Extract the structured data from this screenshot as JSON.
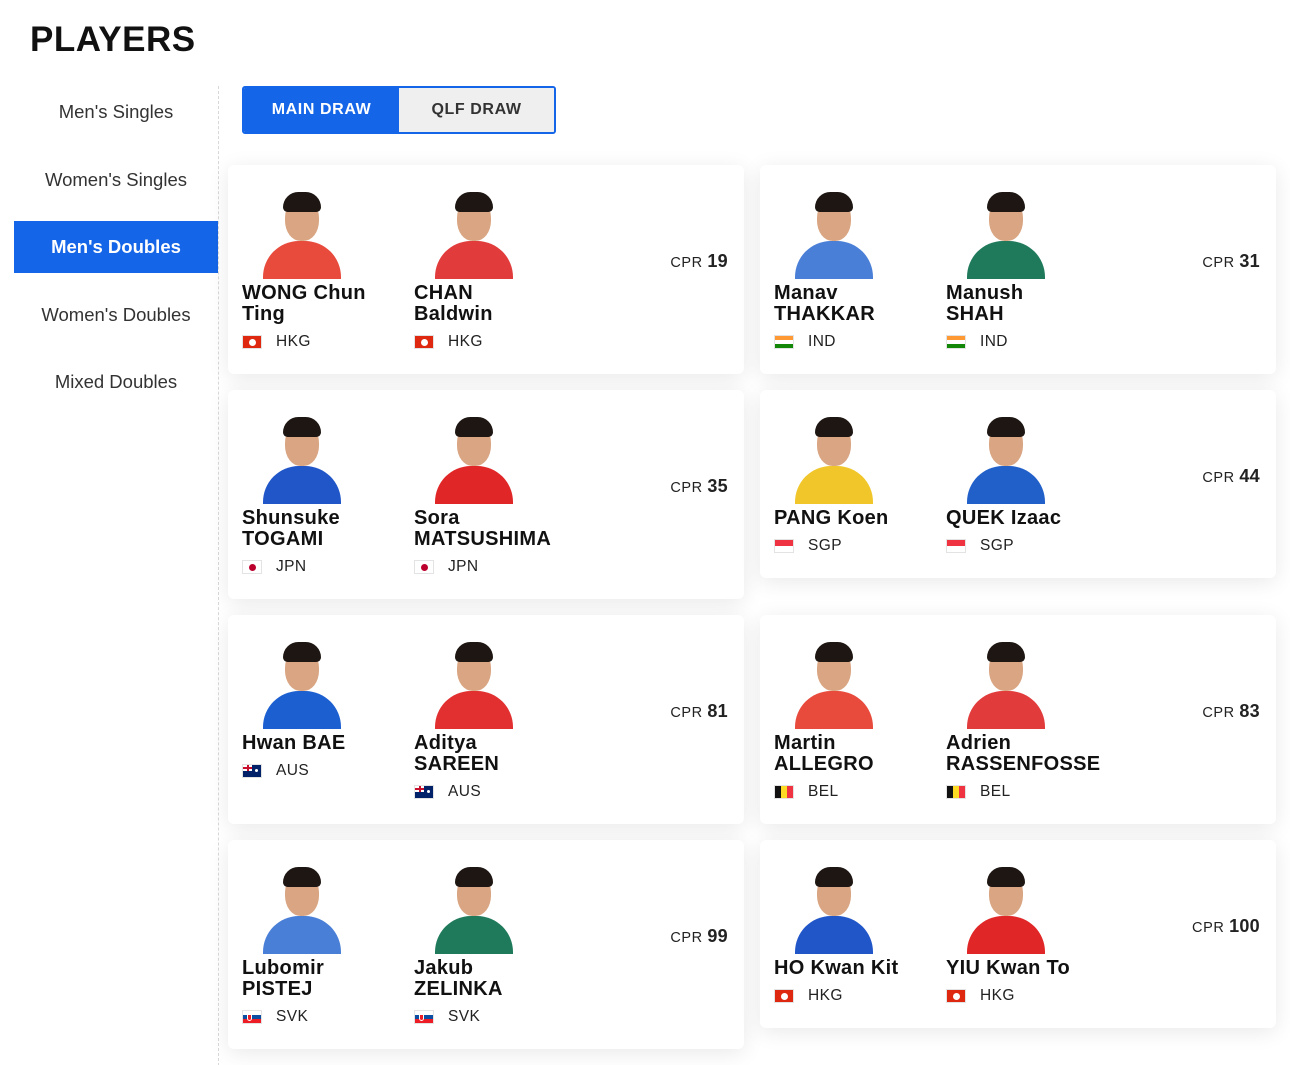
{
  "page": {
    "title": "PLAYERS"
  },
  "sidebar": {
    "items": [
      {
        "label": "Men's Singles",
        "active": false
      },
      {
        "label": "Women's Singles",
        "active": false
      },
      {
        "label": "Men's Doubles",
        "active": true
      },
      {
        "label": "Women's Doubles",
        "active": false
      },
      {
        "label": "Mixed Doubles",
        "active": false
      }
    ]
  },
  "draw_toggle": {
    "main_label": "MAIN DRAW",
    "qlf_label": "QLF DRAW",
    "selected": "MAIN DRAW"
  },
  "colors": {
    "accent": "#1565e8"
  },
  "cpr_label": "CPR",
  "pairs": [
    {
      "cpr": "19",
      "players": [
        {
          "name_line1": "WONG Chun",
          "name_line2": "Ting",
          "country": "HKG",
          "flag": "flag-hkg-icon"
        },
        {
          "name_line1": "CHAN",
          "name_line2": "Baldwin",
          "country": "HKG",
          "flag": "flag-hkg-icon"
        }
      ]
    },
    {
      "cpr": "31",
      "players": [
        {
          "name_line1": "Manav",
          "name_line2": "THAKKAR",
          "country": "IND",
          "flag": "flag-ind-icon"
        },
        {
          "name_line1": "Manush",
          "name_line2": "SHAH",
          "country": "IND",
          "flag": "flag-ind-icon"
        }
      ]
    },
    {
      "cpr": "35",
      "players": [
        {
          "name_line1": "Shunsuke",
          "name_line2": "TOGAMI",
          "country": "JPN",
          "flag": "flag-jpn-icon"
        },
        {
          "name_line1": "Sora",
          "name_line2": "MATSUSHIMA",
          "country": "JPN",
          "flag": "flag-jpn-icon"
        }
      ]
    },
    {
      "cpr": "44",
      "players": [
        {
          "name_line1": "PANG Koen",
          "name_line2": "",
          "country": "SGP",
          "flag": "flag-sgp-icon"
        },
        {
          "name_line1": "QUEK Izaac",
          "name_line2": "",
          "country": "SGP",
          "flag": "flag-sgp-icon"
        }
      ]
    },
    {
      "cpr": "81",
      "players": [
        {
          "name_line1": "Hwan BAE",
          "name_line2": "",
          "country": "AUS",
          "flag": "flag-aus-icon"
        },
        {
          "name_line1": "Aditya",
          "name_line2": "SAREEN",
          "country": "AUS",
          "flag": "flag-aus-icon"
        }
      ]
    },
    {
      "cpr": "83",
      "players": [
        {
          "name_line1": "Martin",
          "name_line2": "ALLEGRO",
          "country": "BEL",
          "flag": "flag-bel-icon"
        },
        {
          "name_line1": "Adrien",
          "name_line2": "RASSENFOSSE",
          "country": "BEL",
          "flag": "flag-bel-icon"
        }
      ]
    },
    {
      "cpr": "99",
      "players": [
        {
          "name_line1": "Lubomir",
          "name_line2": "PISTEJ",
          "country": "SVK",
          "flag": "flag-svk-icon"
        },
        {
          "name_line1": "Jakub",
          "name_line2": "ZELINKA",
          "country": "SVK",
          "flag": "flag-svk-icon"
        }
      ]
    },
    {
      "cpr": "100",
      "players": [
        {
          "name_line1": "HO Kwan Kit",
          "name_line2": "",
          "country": "HKG",
          "flag": "flag-hkg-icon"
        },
        {
          "name_line1": "YIU Kwan To",
          "name_line2": "",
          "country": "HKG",
          "flag": "flag-hkg-icon"
        }
      ]
    }
  ]
}
